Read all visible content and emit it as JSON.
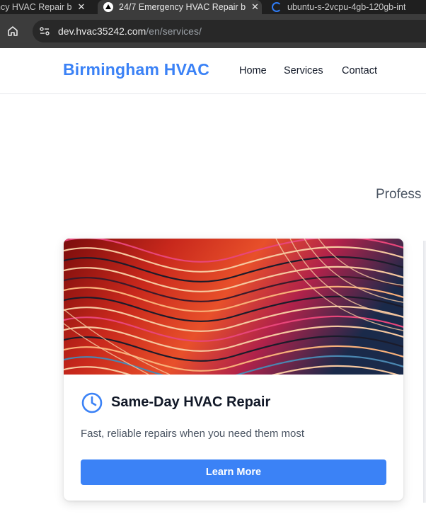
{
  "browser": {
    "tabs": [
      {
        "title": "ncy HVAC Repair b",
        "active": false
      },
      {
        "title": "24/7 Emergency HVAC Repair b",
        "active": true
      },
      {
        "title": "ubuntu-s-2vcpu-4gb-120gb-int",
        "active": false
      }
    ],
    "close_glyph": "✕",
    "url_host": "dev.hvac35242.com",
    "url_path": "/en/services/"
  },
  "header": {
    "brand": "Birmingham HVAC",
    "nav": {
      "home": "Home",
      "services": "Services",
      "contact": "Contact"
    }
  },
  "hero": {
    "subtitle": "Profess"
  },
  "card": {
    "icon": "clock-icon",
    "title": "Same-Day HVAC Repair",
    "description": "Fast, reliable repairs when you need them most",
    "button_label": "Learn More"
  },
  "colors": {
    "accent": "#3b82f6",
    "text_dark": "#111827",
    "text_muted": "#4b5563",
    "chrome_dark": "#1f1f1f",
    "chrome_toolbar": "#3c3c3c"
  }
}
